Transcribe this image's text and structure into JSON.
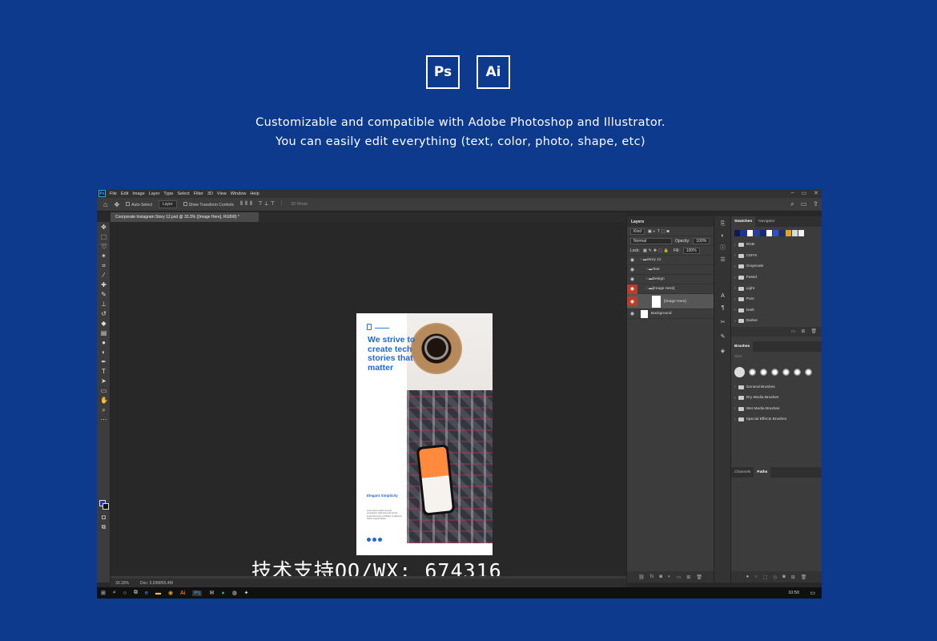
{
  "badges": [
    "Ps",
    "Ai"
  ],
  "tagline": {
    "line1": "Customizable and compatible with Adobe Photoshop and Illustrator.",
    "line2": "You can easily edit everything (text, color, photo, shape, etc)"
  },
  "app": {
    "logo": "Ps",
    "menu": [
      "File",
      "Edit",
      "Image",
      "Layer",
      "Type",
      "Select",
      "Filter",
      "3D",
      "View",
      "Window",
      "Help"
    ],
    "window_controls": [
      "–",
      "▭",
      "✕"
    ],
    "options": {
      "auto_select": "Auto-Select",
      "target": "Layer",
      "transform": "Show Transform Controls",
      "mode_3d": "3D Mode:"
    },
    "document_tab": "Coorporate Instagram Story 12.psd @ 33.3% ([Image Here], RGB/8) *",
    "status": {
      "zoom": "33.33%",
      "doc": "Doc: 5.93M/65.4M"
    }
  },
  "artboard": {
    "headline": "We strive to create tech stories that matter",
    "subhead": "Elegant Simplicity",
    "body": "Lorem ipsum dolor sit amet consectetur adipiscing elit sed do eiusmod tempor incididunt ut labore et dolore magna aliqua."
  },
  "watermark": "技术支持QQ/WX: 674316",
  "layers_panel": {
    "title": "Layers",
    "filter": "Kind",
    "blend": "Normal",
    "opacity_label": "Opacity:",
    "opacity": "100%",
    "lock_label": "Lock:",
    "fill_label": "Fill:",
    "fill": "100%",
    "layers": [
      {
        "name": "Story 12",
        "indent": 0,
        "kind": "folder",
        "red": false
      },
      {
        "name": "Text",
        "indent": 1,
        "kind": "folder",
        "red": false
      },
      {
        "name": "Design",
        "indent": 1,
        "kind": "folder",
        "red": false
      },
      {
        "name": "[Image Here]",
        "indent": 1,
        "kind": "folder",
        "red": true
      },
      {
        "name": "[Image Here]",
        "indent": 2,
        "kind": "smart",
        "red": true
      },
      {
        "name": "Background",
        "indent": 0,
        "kind": "layer",
        "red": false
      }
    ]
  },
  "swatches_panel": {
    "tabs": [
      "Swatches",
      "Navigator"
    ],
    "colors": [
      "#0b1a5c",
      "#1234a8",
      "#ffffff",
      "#1d3fb8",
      "#0f2a82",
      "#ffffff",
      "#2a4fd0",
      "#1a2f7a",
      "#e8a020",
      "#d9d9d9",
      "#f2f2f2"
    ],
    "folders": [
      "RGB",
      "CMYK",
      "Grayscale",
      "Pastel",
      "Light",
      "Pure",
      "Dark",
      "Darker"
    ]
  },
  "brushes_panel": {
    "title": "Brushes",
    "size_label": "Size:",
    "folders": [
      "General Brushes",
      "Dry Media Brushes",
      "Wet Media Brushes",
      "Special Effects Brushes"
    ]
  },
  "bottom_panel": {
    "tabs": [
      "Channels",
      "Paths"
    ]
  },
  "taskbar": {
    "time": "10:50"
  }
}
